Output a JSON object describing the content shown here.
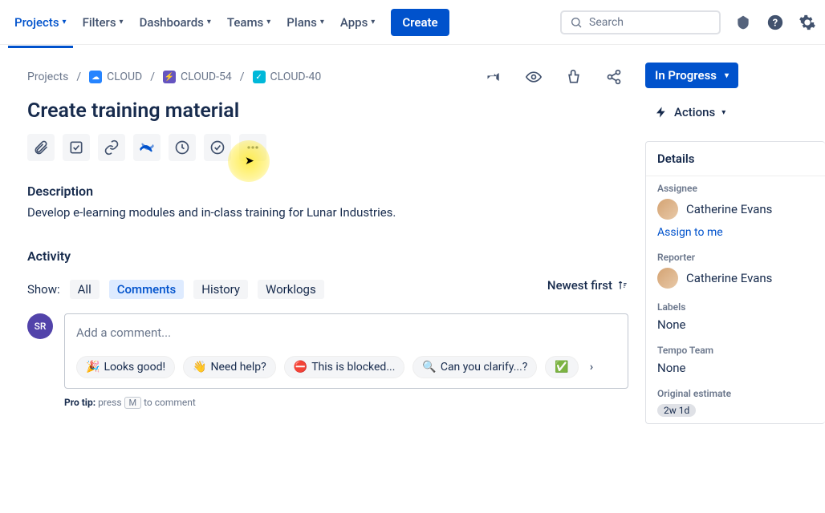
{
  "nav": {
    "items": [
      "Projects",
      "Filters",
      "Dashboards",
      "Teams",
      "Plans",
      "Apps"
    ],
    "create": "Create",
    "search_placeholder": "Search"
  },
  "breadcrumbs": {
    "root": "Projects",
    "project": "CLOUD",
    "parent": "CLOUD-54",
    "current": "CLOUD-40"
  },
  "issue": {
    "title": "Create training material",
    "description_label": "Description",
    "description_text": "Develop e-learning modules and in-class training for Lunar Industries."
  },
  "activity": {
    "title": "Activity",
    "show_label": "Show:",
    "tabs": [
      "All",
      "Comments",
      "History",
      "Worklogs"
    ],
    "sort": "Newest first",
    "comment_placeholder": "Add a comment...",
    "avatar_initials": "SR",
    "chips": [
      {
        "emoji": "🎉",
        "text": "Looks good!"
      },
      {
        "emoji": "👋",
        "text": "Need help?"
      },
      {
        "emoji": "⛔",
        "text": "This is blocked..."
      },
      {
        "emoji": "🔍",
        "text": "Can you clarify...?"
      },
      {
        "emoji": "✅",
        "text": ""
      }
    ],
    "protip_label": "Pro tip:",
    "protip_before": "press",
    "protip_key": "M",
    "protip_after": "to comment"
  },
  "side": {
    "status": "In Progress",
    "actions": "Actions",
    "details_title": "Details",
    "assignee_label": "Assignee",
    "assignee_value": "Catherine Evans",
    "assign_to_me": "Assign to me",
    "reporter_label": "Reporter",
    "reporter_value": "Catherine Evans",
    "labels_label": "Labels",
    "labels_value": "None",
    "tempo_label": "Tempo Team",
    "tempo_value": "None",
    "estimate_label": "Original estimate",
    "estimate_value": "2w 1d"
  }
}
